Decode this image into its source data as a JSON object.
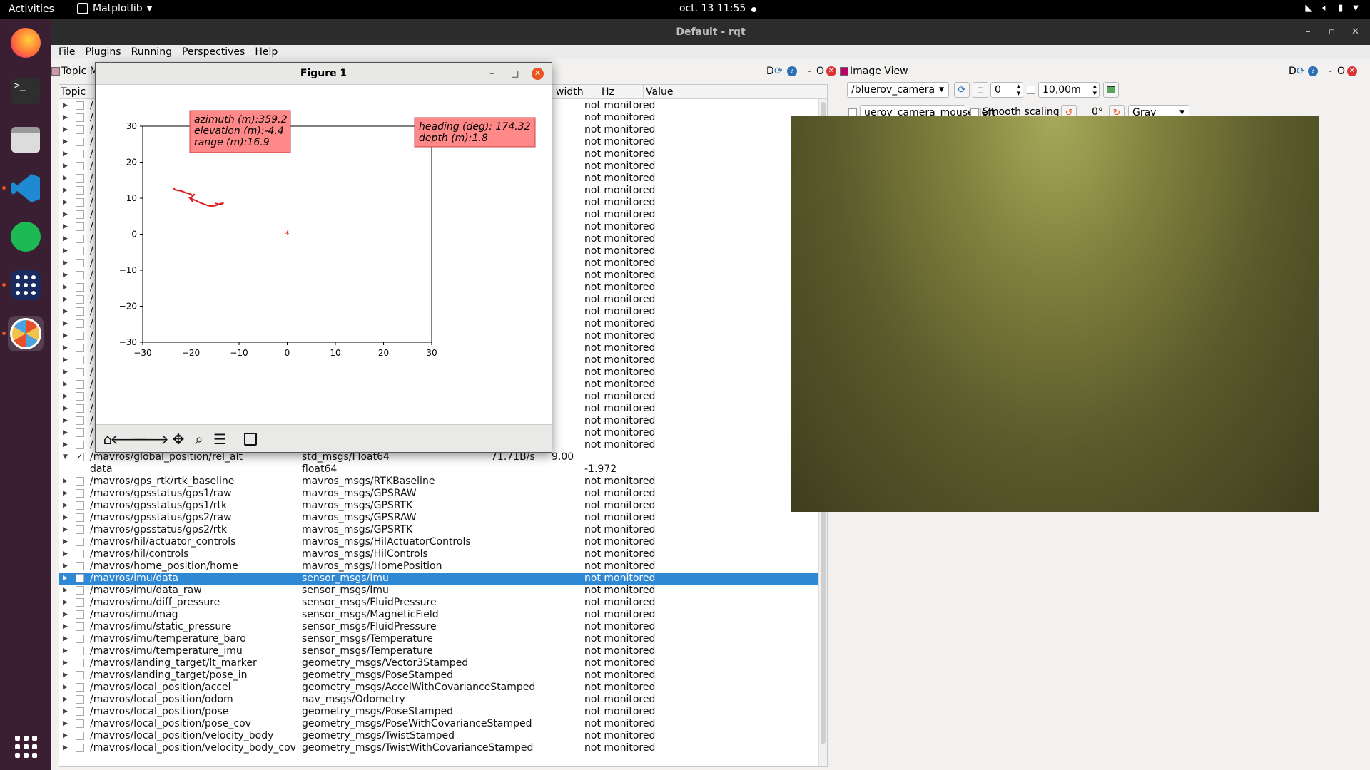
{
  "topbar": {
    "activities": "Activities",
    "app_name": "Matplotlib",
    "clock": "oct. 13  11:55"
  },
  "dock": {
    "items": [
      "firefox-icon",
      "terminal-icon",
      "files-icon",
      "vscode-icon",
      "spotify-icon",
      "app-grid-icon",
      "rqt-icon"
    ]
  },
  "window": {
    "title": "Default - rqt"
  },
  "menu": [
    "File",
    "Plugins",
    "Running",
    "Perspectives",
    "Help"
  ],
  "topic_monitor": {
    "title": "Topic M",
    "header_ctrl": "D",
    "columns": {
      "topic": "Topic",
      "bandwidth": "width",
      "hz": "Hz",
      "value": "Value"
    },
    "hidden_rows": [
      "/",
      "/",
      "/",
      "/",
      "/",
      "/",
      "/",
      "/",
      "/",
      "/",
      "/",
      "/",
      "/",
      "/",
      "/",
      "/",
      "/",
      "/",
      "/",
      "/",
      "/",
      "/",
      "/",
      "/",
      "/",
      "/",
      "/",
      "/",
      "/"
    ],
    "hidden_value": "not monitored",
    "rows": [
      {
        "topic": "/mavros/global_position/rel_alt",
        "type": "std_msgs/Float64",
        "bw": "71.71B/s",
        "hz": "9.00",
        "value": "",
        "expanded": true,
        "checked": true
      },
      {
        "topic": "data",
        "type": "float64",
        "bw": "",
        "hz": "",
        "value": "-1.972",
        "child": true
      },
      {
        "topic": "/mavros/gps_rtk/rtk_baseline",
        "type": "mavros_msgs/RTKBaseline",
        "value": "not monitored"
      },
      {
        "topic": "/mavros/gpsstatus/gps1/raw",
        "type": "mavros_msgs/GPSRAW",
        "value": "not monitored"
      },
      {
        "topic": "/mavros/gpsstatus/gps1/rtk",
        "type": "mavros_msgs/GPSRTK",
        "value": "not monitored"
      },
      {
        "topic": "/mavros/gpsstatus/gps2/raw",
        "type": "mavros_msgs/GPSRAW",
        "value": "not monitored"
      },
      {
        "topic": "/mavros/gpsstatus/gps2/rtk",
        "type": "mavros_msgs/GPSRTK",
        "value": "not monitored"
      },
      {
        "topic": "/mavros/hil/actuator_controls",
        "type": "mavros_msgs/HilActuatorControls",
        "value": "not monitored"
      },
      {
        "topic": "/mavros/hil/controls",
        "type": "mavros_msgs/HilControls",
        "value": "not monitored"
      },
      {
        "topic": "/mavros/home_position/home",
        "type": "mavros_msgs/HomePosition",
        "value": "not monitored"
      },
      {
        "topic": "/mavros/imu/data",
        "type": "sensor_msgs/Imu",
        "value": "not monitored",
        "selected": true
      },
      {
        "topic": "/mavros/imu/data_raw",
        "type": "sensor_msgs/Imu",
        "value": "not monitored"
      },
      {
        "topic": "/mavros/imu/diff_pressure",
        "type": "sensor_msgs/FluidPressure",
        "value": "not monitored"
      },
      {
        "topic": "/mavros/imu/mag",
        "type": "sensor_msgs/MagneticField",
        "value": "not monitored"
      },
      {
        "topic": "/mavros/imu/static_pressure",
        "type": "sensor_msgs/FluidPressure",
        "value": "not monitored"
      },
      {
        "topic": "/mavros/imu/temperature_baro",
        "type": "sensor_msgs/Temperature",
        "value": "not monitored"
      },
      {
        "topic": "/mavros/imu/temperature_imu",
        "type": "sensor_msgs/Temperature",
        "value": "not monitored"
      },
      {
        "topic": "/mavros/landing_target/lt_marker",
        "type": "geometry_msgs/Vector3Stamped",
        "value": "not monitored"
      },
      {
        "topic": "/mavros/landing_target/pose_in",
        "type": "geometry_msgs/PoseStamped",
        "value": "not monitored"
      },
      {
        "topic": "/mavros/local_position/accel",
        "type": "geometry_msgs/AccelWithCovarianceStamped",
        "value": "not monitored"
      },
      {
        "topic": "/mavros/local_position/odom",
        "type": "nav_msgs/Odometry",
        "value": "not monitored"
      },
      {
        "topic": "/mavros/local_position/pose",
        "type": "geometry_msgs/PoseStamped",
        "value": "not monitored"
      },
      {
        "topic": "/mavros/local_position/pose_cov",
        "type": "geometry_msgs/PoseWithCovarianceStamped",
        "value": "not monitored"
      },
      {
        "topic": "/mavros/local_position/velocity_body",
        "type": "geometry_msgs/TwistStamped",
        "value": "not monitored"
      },
      {
        "topic": "/mavros/local_position/velocity_body_cov",
        "type": "geometry_msgs/TwistWithCovarianceStamped",
        "value": "not monitored"
      }
    ]
  },
  "image_view": {
    "title": "Image View",
    "topic": "/bluerov_camera",
    "num_value": "0",
    "max_range": "10,00m",
    "mouse_topic": "uerov_camera_mouse_left",
    "smooth_label": "Smooth scaling",
    "rotation": "0°",
    "color_scheme": "Gray"
  },
  "figure": {
    "title": "Figure 1",
    "annotation_left": [
      "azimuth (m):359.2",
      "elevation (m):-4.4",
      "range (m):16.9"
    ],
    "annotation_right": [
      "heading (deg): 174.32",
      "depth (m):1.8"
    ]
  },
  "chart_data": {
    "type": "line",
    "xlim": [
      -30,
      30
    ],
    "ylim": [
      -30,
      30
    ],
    "xticks": [
      "−30",
      "−20",
      "−10",
      "0",
      "10",
      "20",
      "30"
    ],
    "yticks": [
      "30",
      "20",
      "10",
      "0",
      "−10",
      "−20",
      "−30"
    ],
    "tick_values": [
      -30,
      -20,
      -10,
      0,
      10,
      20,
      30
    ],
    "marker": {
      "x": 0,
      "y": 0
    },
    "series": [
      {
        "color": "#e02020",
        "x": [
          -23.8,
          -23.2,
          -22,
          -21,
          -20,
          -19.6,
          -19.2,
          -19.9,
          -19.6,
          -20.2,
          -19.1,
          -18,
          -17,
          -16,
          -15,
          -14,
          -13.2,
          -13.8,
          -15
        ],
        "y": [
          13,
          12.3,
          12,
          11.5,
          11.1,
          10.6,
          11.2,
          10.2,
          9,
          10,
          9.4,
          8.7,
          8.2,
          7.8,
          7.9,
          8.4,
          8.7,
          8.2,
          8.6
        ]
      }
    ]
  }
}
